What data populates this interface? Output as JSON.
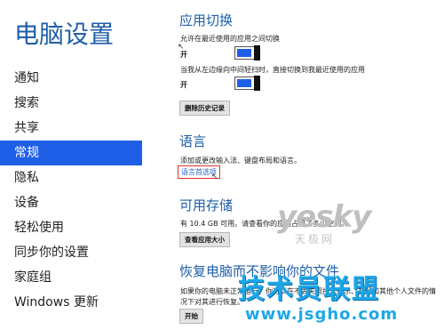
{
  "sidebar": {
    "title": "电脑设置",
    "items": [
      {
        "label": "通知"
      },
      {
        "label": "搜索"
      },
      {
        "label": "共享"
      },
      {
        "label": "常规"
      },
      {
        "label": "隐私"
      },
      {
        "label": "设备"
      },
      {
        "label": "轻松使用"
      },
      {
        "label": "同步你的设置"
      },
      {
        "label": "家庭组"
      },
      {
        "label": "Windows 更新"
      }
    ],
    "active_index": 3
  },
  "app_switching": {
    "title": "应用切换",
    "setting1_desc": "允许在最近使用的应用之间切换",
    "setting1_state": "开",
    "setting2_desc": "当我从左边缘向中间轻扫时，直接切换到我最近使用的应用",
    "setting2_state": "开",
    "clear_history_button": "删除历史记录"
  },
  "language": {
    "title": "语言",
    "desc": "添加或更改输入法、键盘布局和语言。",
    "preferences_link": "语言首选项"
  },
  "storage": {
    "title": "可用存储",
    "desc": "有 10.4 GB 可用。请查看你的应用占用了多少空间。",
    "view_app_sizes_button": "查看应用大小"
  },
  "recovery": {
    "title": "恢复电脑而不影响你的文件",
    "desc_line1": "如果你的电脑未正常运行，你可以在不丢失照片、音乐、视频和其他个人文件的情",
    "desc_line2": "况下对其进行恢复。",
    "start_button": "开始"
  },
  "watermarks": {
    "yesky": "yesky",
    "yesky_sub": "天极网",
    "site_name": "技术员联盟",
    "site_url": "www.jsgho.com"
  }
}
